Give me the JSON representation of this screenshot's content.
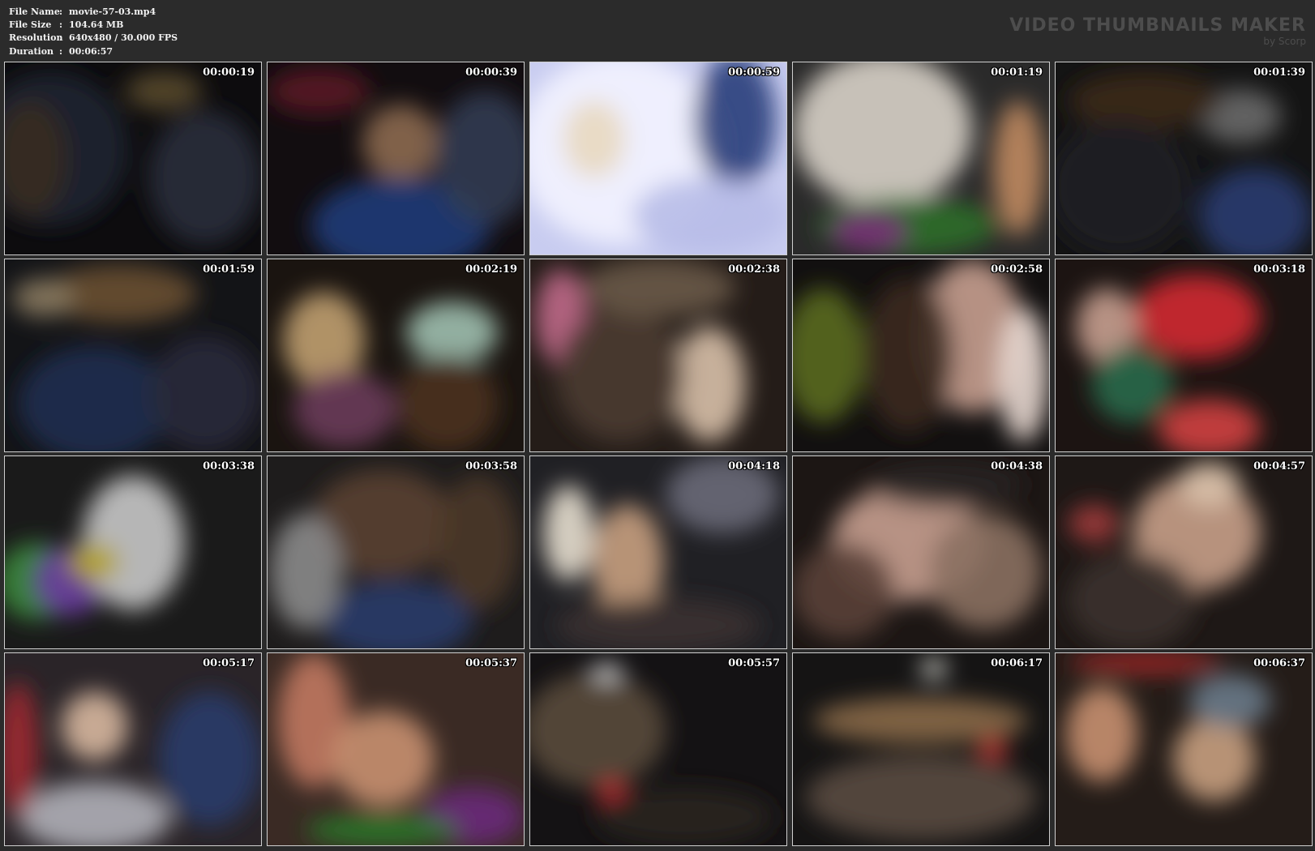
{
  "meta": {
    "rows": [
      {
        "label": "File Name",
        "sep": ":",
        "value": "movie-57-03.mp4"
      },
      {
        "label": "File Size",
        "sep": ":",
        "value": "104.64 MB"
      },
      {
        "label": "Resolution",
        "sep": ":",
        "value": "640x480 / 30.000 FPS"
      },
      {
        "label": "Duration",
        "sep": ":",
        "value": "00:06:57"
      }
    ]
  },
  "brand": {
    "title": "VIDEO THUMBNAILS MAKER",
    "subtitle": "by Scorp"
  },
  "frames": [
    {
      "time": "00:00:19",
      "base": "#0d0c0e",
      "blobs": [
        [
          "#1c2430",
          0.18,
          0.45,
          0.3,
          0.4
        ],
        [
          "#5a4a2e",
          0.62,
          0.15,
          0.15,
          0.1
        ],
        [
          "#2a2f3b",
          0.78,
          0.6,
          0.22,
          0.35
        ],
        [
          "#3a2a22",
          0.1,
          0.5,
          0.14,
          0.3
        ]
      ]
    },
    {
      "time": "00:00:39",
      "base": "#120d10",
      "blobs": [
        [
          "#8c6a50",
          0.52,
          0.42,
          0.15,
          0.2
        ],
        [
          "#1d3b78",
          0.52,
          0.85,
          0.35,
          0.25
        ],
        [
          "#5a1a22",
          0.2,
          0.15,
          0.2,
          0.12
        ],
        [
          "#303a52",
          0.85,
          0.5,
          0.2,
          0.35
        ]
      ]
    },
    {
      "time": "00:00:59",
      "base": "#c8ccf0",
      "blobs": [
        [
          "#f3f3ff",
          0.35,
          0.45,
          0.4,
          0.5
        ],
        [
          "#2a3f7a",
          0.8,
          0.3,
          0.16,
          0.35
        ],
        [
          "#e8d8c0",
          0.25,
          0.4,
          0.12,
          0.2
        ],
        [
          "#b8bce8",
          0.7,
          0.8,
          0.3,
          0.2
        ]
      ]
    },
    {
      "time": "00:01:19",
      "base": "#2a2a2a",
      "blobs": [
        [
          "#d8d2c8",
          0.35,
          0.35,
          0.35,
          0.4
        ],
        [
          "#2e6e2a",
          0.45,
          0.85,
          0.35,
          0.15
        ],
        [
          "#7a2a7a",
          0.3,
          0.88,
          0.15,
          0.1
        ],
        [
          "#c08a60",
          0.88,
          0.55,
          0.1,
          0.35
        ]
      ]
    },
    {
      "time": "00:01:39",
      "base": "#141414",
      "blobs": [
        [
          "#6a6a6a",
          0.72,
          0.28,
          0.16,
          0.14
        ],
        [
          "#2a3a70",
          0.78,
          0.8,
          0.22,
          0.25
        ],
        [
          "#3a2a1a",
          0.35,
          0.2,
          0.3,
          0.15
        ],
        [
          "#1e1e22",
          0.25,
          0.65,
          0.28,
          0.35
        ]
      ]
    }
  ],
  "frames2": [
    {
      "time": "00:01:59",
      "base": "#131417",
      "blobs": [
        [
          "#6a5030",
          0.45,
          0.18,
          0.3,
          0.15
        ],
        [
          "#1e2c50",
          0.35,
          0.75,
          0.3,
          0.3
        ],
        [
          "#2a2a3a",
          0.78,
          0.7,
          0.22,
          0.3
        ],
        [
          "#8a7a60",
          0.15,
          0.2,
          0.12,
          0.1
        ]
      ]
    },
    {
      "time": "00:02:19",
      "base": "#1a1410",
      "blobs": [
        [
          "#c0a070",
          0.22,
          0.42,
          0.16,
          0.25
        ],
        [
          "#a0c0b0",
          0.72,
          0.38,
          0.18,
          0.16
        ],
        [
          "#6a3a5a",
          0.3,
          0.78,
          0.2,
          0.2
        ],
        [
          "#4a3020",
          0.7,
          0.75,
          0.2,
          0.25
        ]
      ]
    },
    {
      "time": "00:02:38",
      "base": "#241c18",
      "blobs": [
        [
          "#c06a8a",
          0.12,
          0.3,
          0.1,
          0.25
        ],
        [
          "#d8c0a8",
          0.7,
          0.65,
          0.14,
          0.3
        ],
        [
          "#4a3a30",
          0.35,
          0.6,
          0.25,
          0.35
        ],
        [
          "#6a5a48",
          0.5,
          0.15,
          0.3,
          0.15
        ]
      ]
    },
    {
      "time": "00:02:58",
      "base": "#121010",
      "blobs": [
        [
          "#5a6a20",
          0.12,
          0.5,
          0.16,
          0.35
        ],
        [
          "#c8a090",
          0.7,
          0.4,
          0.2,
          0.4
        ],
        [
          "#3a2a20",
          0.45,
          0.5,
          0.18,
          0.4
        ],
        [
          "#e8d8d0",
          0.9,
          0.6,
          0.1,
          0.35
        ]
      ]
    },
    {
      "time": "00:03:18",
      "base": "#1c1412",
      "blobs": [
        [
          "#d02a30",
          0.55,
          0.3,
          0.25,
          0.22
        ],
        [
          "#c8a090",
          0.2,
          0.35,
          0.12,
          0.2
        ],
        [
          "#2a6a4a",
          0.3,
          0.65,
          0.16,
          0.2
        ],
        [
          "#d04040",
          0.6,
          0.88,
          0.2,
          0.15
        ]
      ]
    }
  ],
  "frames3": [
    {
      "time": "00:03:38",
      "base": "#1a1a1a",
      "blobs": [
        [
          "#3a8a3a",
          0.12,
          0.65,
          0.15,
          0.2
        ],
        [
          "#6a3aa0",
          0.25,
          0.65,
          0.14,
          0.18
        ],
        [
          "#c8c8c8",
          0.5,
          0.45,
          0.2,
          0.35
        ],
        [
          "#b0a020",
          0.35,
          0.55,
          0.1,
          0.1
        ]
      ]
    },
    {
      "time": "00:03:58",
      "base": "#1e1c1c",
      "blobs": [
        [
          "#5a4030",
          0.45,
          0.35,
          0.28,
          0.28
        ],
        [
          "#2a3a6a",
          0.5,
          0.85,
          0.3,
          0.2
        ],
        [
          "#8a8a8a",
          0.15,
          0.6,
          0.14,
          0.3
        ],
        [
          "#4a3828",
          0.82,
          0.45,
          0.16,
          0.35
        ]
      ]
    },
    {
      "time": "00:04:18",
      "base": "#202024",
      "blobs": [
        [
          "#c8a080",
          0.38,
          0.55,
          0.14,
          0.3
        ],
        [
          "#6a6a78",
          0.75,
          0.2,
          0.22,
          0.2
        ],
        [
          "#e8e0d0",
          0.15,
          0.4,
          0.1,
          0.25
        ],
        [
          "#3a3230",
          0.5,
          0.88,
          0.4,
          0.14
        ]
      ]
    },
    {
      "time": "00:04:38",
      "base": "#1c1614",
      "blobs": [
        [
          "#c8a090",
          0.45,
          0.45,
          0.3,
          0.3
        ],
        [
          "#5a4038",
          0.2,
          0.7,
          0.2,
          0.25
        ],
        [
          "#8a7060",
          0.75,
          0.6,
          0.22,
          0.3
        ],
        [
          "#2a2624",
          0.6,
          0.15,
          0.3,
          0.12
        ]
      ]
    },
    {
      "time": "00:04:57",
      "base": "#1e1816",
      "blobs": [
        [
          "#c8a088",
          0.55,
          0.4,
          0.25,
          0.3
        ],
        [
          "#a03a3a",
          0.15,
          0.35,
          0.1,
          0.1
        ],
        [
          "#d8c0a8",
          0.6,
          0.15,
          0.12,
          0.12
        ],
        [
          "#3a302c",
          0.3,
          0.75,
          0.25,
          0.25
        ]
      ]
    }
  ],
  "frames4": [
    {
      "time": "00:05:17",
      "base": "#2a2428",
      "blobs": [
        [
          "#d8b8a0",
          0.35,
          0.38,
          0.13,
          0.18
        ],
        [
          "#b0b0b8",
          0.35,
          0.85,
          0.3,
          0.18
        ],
        [
          "#a02a30",
          0.05,
          0.5,
          0.08,
          0.35
        ],
        [
          "#2a3a6a",
          0.8,
          0.55,
          0.2,
          0.35
        ]
      ]
    },
    {
      "time": "00:05:37",
      "base": "#3a2a24",
      "blobs": [
        [
          "#c07860",
          0.18,
          0.35,
          0.14,
          0.35
        ],
        [
          "#c89070",
          0.45,
          0.55,
          0.2,
          0.25
        ],
        [
          "#6a2a7a",
          0.8,
          0.85,
          0.2,
          0.15
        ],
        [
          "#2a7a2a",
          0.45,
          0.92,
          0.3,
          0.08
        ]
      ]
    },
    {
      "time": "00:05:57",
      "base": "#141214",
      "blobs": [
        [
          "#5a4a3a",
          0.25,
          0.4,
          0.28,
          0.3
        ],
        [
          "#d0d0d0",
          0.3,
          0.1,
          0.06,
          0.05
        ],
        [
          "#c02a30",
          0.32,
          0.72,
          0.06,
          0.06
        ],
        [
          "#2a2420",
          0.6,
          0.85,
          0.35,
          0.15
        ]
      ]
    },
    {
      "time": "00:06:17",
      "base": "#151414",
      "blobs": [
        [
          "#8a6a48",
          0.5,
          0.35,
          0.42,
          0.12
        ],
        [
          "#e8e8e0",
          0.55,
          0.08,
          0.05,
          0.05
        ],
        [
          "#5a4a40",
          0.5,
          0.75,
          0.45,
          0.22
        ],
        [
          "#c03030",
          0.78,
          0.5,
          0.06,
          0.06
        ]
      ]
    },
    {
      "time": "00:06:37",
      "base": "#241c18",
      "blobs": [
        [
          "#c89070",
          0.18,
          0.42,
          0.14,
          0.25
        ],
        [
          "#c8a080",
          0.62,
          0.55,
          0.16,
          0.22
        ],
        [
          "#6a7a8a",
          0.68,
          0.25,
          0.16,
          0.14
        ],
        [
          "#a02a2a",
          0.35,
          0.05,
          0.3,
          0.06
        ]
      ]
    }
  ]
}
